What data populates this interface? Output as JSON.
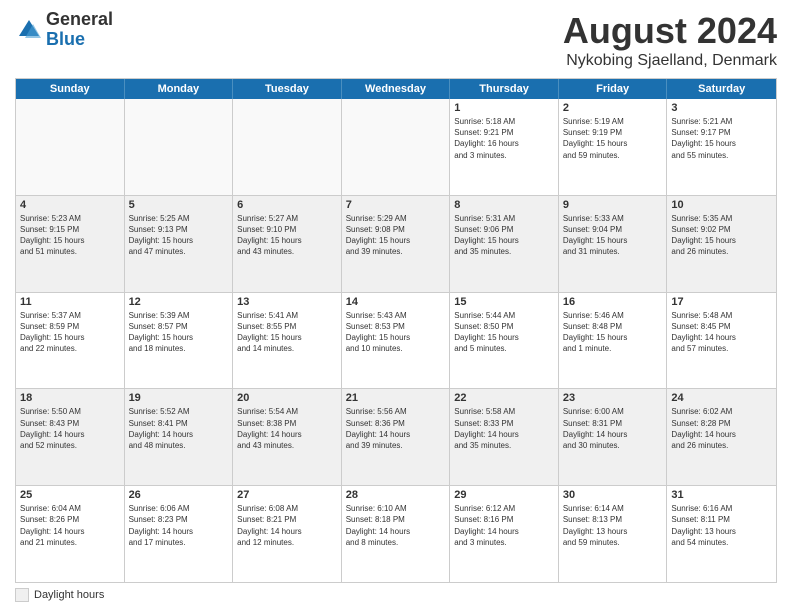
{
  "header": {
    "logo": {
      "general": "General",
      "blue": "Blue"
    },
    "title": "August 2024",
    "subtitle": "Nykobing Sjaelland, Denmark"
  },
  "calendar": {
    "days": [
      "Sunday",
      "Monday",
      "Tuesday",
      "Wednesday",
      "Thursday",
      "Friday",
      "Saturday"
    ],
    "rows": [
      [
        {
          "day": "",
          "text": "",
          "empty": true
        },
        {
          "day": "",
          "text": "",
          "empty": true
        },
        {
          "day": "",
          "text": "",
          "empty": true
        },
        {
          "day": "",
          "text": "",
          "empty": true
        },
        {
          "day": "1",
          "text": "Sunrise: 5:18 AM\nSunset: 9:21 PM\nDaylight: 16 hours\nand 3 minutes.",
          "empty": false
        },
        {
          "day": "2",
          "text": "Sunrise: 5:19 AM\nSunset: 9:19 PM\nDaylight: 15 hours\nand 59 minutes.",
          "empty": false
        },
        {
          "day": "3",
          "text": "Sunrise: 5:21 AM\nSunset: 9:17 PM\nDaylight: 15 hours\nand 55 minutes.",
          "empty": false
        }
      ],
      [
        {
          "day": "4",
          "text": "Sunrise: 5:23 AM\nSunset: 9:15 PM\nDaylight: 15 hours\nand 51 minutes.",
          "empty": false
        },
        {
          "day": "5",
          "text": "Sunrise: 5:25 AM\nSunset: 9:13 PM\nDaylight: 15 hours\nand 47 minutes.",
          "empty": false
        },
        {
          "day": "6",
          "text": "Sunrise: 5:27 AM\nSunset: 9:10 PM\nDaylight: 15 hours\nand 43 minutes.",
          "empty": false
        },
        {
          "day": "7",
          "text": "Sunrise: 5:29 AM\nSunset: 9:08 PM\nDaylight: 15 hours\nand 39 minutes.",
          "empty": false
        },
        {
          "day": "8",
          "text": "Sunrise: 5:31 AM\nSunset: 9:06 PM\nDaylight: 15 hours\nand 35 minutes.",
          "empty": false
        },
        {
          "day": "9",
          "text": "Sunrise: 5:33 AM\nSunset: 9:04 PM\nDaylight: 15 hours\nand 31 minutes.",
          "empty": false
        },
        {
          "day": "10",
          "text": "Sunrise: 5:35 AM\nSunset: 9:02 PM\nDaylight: 15 hours\nand 26 minutes.",
          "empty": false
        }
      ],
      [
        {
          "day": "11",
          "text": "Sunrise: 5:37 AM\nSunset: 8:59 PM\nDaylight: 15 hours\nand 22 minutes.",
          "empty": false
        },
        {
          "day": "12",
          "text": "Sunrise: 5:39 AM\nSunset: 8:57 PM\nDaylight: 15 hours\nand 18 minutes.",
          "empty": false
        },
        {
          "day": "13",
          "text": "Sunrise: 5:41 AM\nSunset: 8:55 PM\nDaylight: 15 hours\nand 14 minutes.",
          "empty": false
        },
        {
          "day": "14",
          "text": "Sunrise: 5:43 AM\nSunset: 8:53 PM\nDaylight: 15 hours\nand 10 minutes.",
          "empty": false
        },
        {
          "day": "15",
          "text": "Sunrise: 5:44 AM\nSunset: 8:50 PM\nDaylight: 15 hours\nand 5 minutes.",
          "empty": false
        },
        {
          "day": "16",
          "text": "Sunrise: 5:46 AM\nSunset: 8:48 PM\nDaylight: 15 hours\nand 1 minute.",
          "empty": false
        },
        {
          "day": "17",
          "text": "Sunrise: 5:48 AM\nSunset: 8:45 PM\nDaylight: 14 hours\nand 57 minutes.",
          "empty": false
        }
      ],
      [
        {
          "day": "18",
          "text": "Sunrise: 5:50 AM\nSunset: 8:43 PM\nDaylight: 14 hours\nand 52 minutes.",
          "empty": false
        },
        {
          "day": "19",
          "text": "Sunrise: 5:52 AM\nSunset: 8:41 PM\nDaylight: 14 hours\nand 48 minutes.",
          "empty": false
        },
        {
          "day": "20",
          "text": "Sunrise: 5:54 AM\nSunset: 8:38 PM\nDaylight: 14 hours\nand 43 minutes.",
          "empty": false
        },
        {
          "day": "21",
          "text": "Sunrise: 5:56 AM\nSunset: 8:36 PM\nDaylight: 14 hours\nand 39 minutes.",
          "empty": false
        },
        {
          "day": "22",
          "text": "Sunrise: 5:58 AM\nSunset: 8:33 PM\nDaylight: 14 hours\nand 35 minutes.",
          "empty": false
        },
        {
          "day": "23",
          "text": "Sunrise: 6:00 AM\nSunset: 8:31 PM\nDaylight: 14 hours\nand 30 minutes.",
          "empty": false
        },
        {
          "day": "24",
          "text": "Sunrise: 6:02 AM\nSunset: 8:28 PM\nDaylight: 14 hours\nand 26 minutes.",
          "empty": false
        }
      ],
      [
        {
          "day": "25",
          "text": "Sunrise: 6:04 AM\nSunset: 8:26 PM\nDaylight: 14 hours\nand 21 minutes.",
          "empty": false
        },
        {
          "day": "26",
          "text": "Sunrise: 6:06 AM\nSunset: 8:23 PM\nDaylight: 14 hours\nand 17 minutes.",
          "empty": false
        },
        {
          "day": "27",
          "text": "Sunrise: 6:08 AM\nSunset: 8:21 PM\nDaylight: 14 hours\nand 12 minutes.",
          "empty": false
        },
        {
          "day": "28",
          "text": "Sunrise: 6:10 AM\nSunset: 8:18 PM\nDaylight: 14 hours\nand 8 minutes.",
          "empty": false
        },
        {
          "day": "29",
          "text": "Sunrise: 6:12 AM\nSunset: 8:16 PM\nDaylight: 14 hours\nand 3 minutes.",
          "empty": false
        },
        {
          "day": "30",
          "text": "Sunrise: 6:14 AM\nSunset: 8:13 PM\nDaylight: 13 hours\nand 59 minutes.",
          "empty": false
        },
        {
          "day": "31",
          "text": "Sunrise: 6:16 AM\nSunset: 8:11 PM\nDaylight: 13 hours\nand 54 minutes.",
          "empty": false
        }
      ]
    ]
  },
  "footer": {
    "legend_label": "Daylight hours"
  }
}
